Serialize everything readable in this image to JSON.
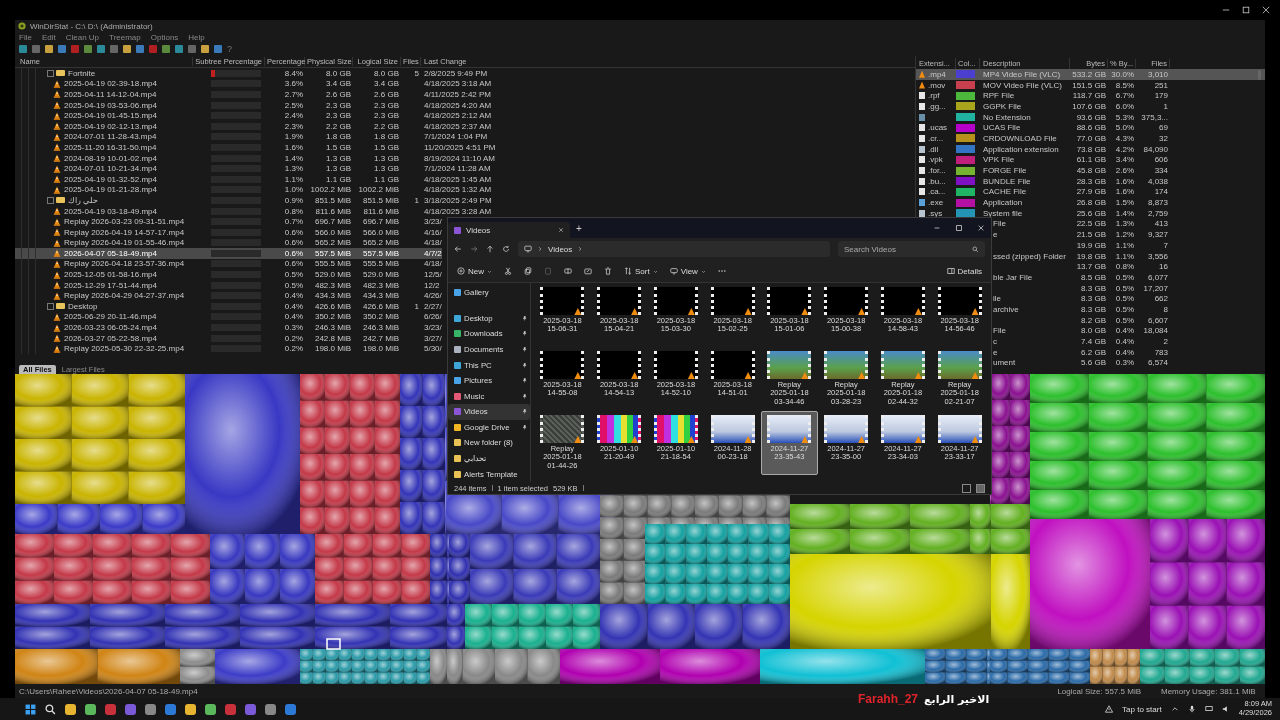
{
  "window": {
    "title": "WinDirStat - C:\\ D:\\ (Administrator)"
  },
  "menu": [
    "File",
    "Edit",
    "Clean Up",
    "Treemap",
    "Options",
    "Help"
  ],
  "toolbar": {
    "help": "?"
  },
  "tree": {
    "columns": [
      "Name",
      "Subtree Percentage",
      "Percentage",
      "Physical Size",
      "Logical Size",
      "Files",
      "Last Change"
    ],
    "rows": [
      {
        "kind": "folder",
        "name": "Fortnite",
        "level": 0.08,
        "pct": "8.4%",
        "phys": "8.0 GB",
        "logical": "8.0 GB",
        "files": "5",
        "changed": "2/8/2025  9:49 PM",
        "selected": false
      },
      {
        "kind": "file",
        "name": "2025-04-19 02-39-18.mp4",
        "pct": "3.6%",
        "phys": "3.4 GB",
        "logical": "3.4 GB",
        "changed": "4/18/2025  3:18 AM",
        "selected": false
      },
      {
        "kind": "file",
        "name": "2025-04-11 14-12-04.mp4",
        "pct": "2.7%",
        "phys": "2.6 GB",
        "logical": "2.6 GB",
        "changed": "4/11/2025  2:42 PM",
        "selected": false
      },
      {
        "kind": "file",
        "name": "2025-04-19 03-53-06.mp4",
        "pct": "2.5%",
        "phys": "2.3 GB",
        "logical": "2.3 GB",
        "changed": "4/18/2025  4:20 AM",
        "selected": false
      },
      {
        "kind": "file",
        "name": "2025-04-19 01-45-15.mp4",
        "pct": "2.4%",
        "phys": "2.3 GB",
        "logical": "2.3 GB",
        "changed": "4/18/2025  2:12 AM",
        "selected": false
      },
      {
        "kind": "file",
        "name": "2025-04-19 02-12-13.mp4",
        "pct": "2.3%",
        "phys": "2.2 GB",
        "logical": "2.2 GB",
        "changed": "4/18/2025  2:37 AM",
        "selected": false
      },
      {
        "kind": "file",
        "name": "2024-07-01 11-28-43.mp4",
        "pct": "1.9%",
        "phys": "1.8 GB",
        "logical": "1.8 GB",
        "changed": "7/1/2024  1:04 PM",
        "selected": false
      },
      {
        "kind": "file",
        "name": "2025-11-20 16-31-50.mp4",
        "pct": "1.6%",
        "phys": "1.5 GB",
        "logical": "1.5 GB",
        "changed": "11/20/2025  4:51 PM",
        "selected": false
      },
      {
        "kind": "file",
        "name": "2024-08-19 10-01-02.mp4",
        "pct": "1.4%",
        "phys": "1.3 GB",
        "logical": "1.3 GB",
        "changed": "8/19/2024  11:10 AM",
        "selected": false
      },
      {
        "kind": "file",
        "name": "2024-07-01 10-21-34.mp4",
        "pct": "1.3%",
        "phys": "1.3 GB",
        "logical": "1.3 GB",
        "changed": "7/1/2024  11:28 AM",
        "selected": false
      },
      {
        "kind": "file",
        "name": "2025-04-19 01-32-52.mp4",
        "pct": "1.1%",
        "phys": "1.1 GB",
        "logical": "1.1 GB",
        "changed": "4/18/2025  1:45 AM",
        "selected": false
      },
      {
        "kind": "file",
        "name": "2025-04-19 01-21-28.mp4",
        "pct": "1.0%",
        "phys": "1002.2 MiB",
        "logical": "1002.2 MiB",
        "changed": "4/18/2025  1:32 AM",
        "selected": false
      },
      {
        "kind": "folder",
        "name": "حلي راك",
        "pct": "0.9%",
        "phys": "851.5 MiB",
        "logical": "851.5 MiB",
        "files": "1",
        "changed": "3/18/2025  2:49 PM",
        "selected": false
      },
      {
        "kind": "file",
        "name": "2025-04-19 03-18-49.mp4",
        "pct": "0.8%",
        "phys": "811.6 MiB",
        "logical": "811.6 MiB",
        "changed": "4/18/2025  3:28 AM",
        "selected": false
      },
      {
        "kind": "file",
        "name": "Replay 2026-03-23 09-31-51.mp4",
        "pct": "0.7%",
        "phys": "696.7 MiB",
        "logical": "696.7 MiB",
        "changed": "3/23/",
        "selected": false
      },
      {
        "kind": "file",
        "name": "Replay 2026-04-19 14-57-17.mp4",
        "pct": "0.6%",
        "phys": "566.0 MiB",
        "logical": "566.0 MiB",
        "changed": "4/16/",
        "selected": false
      },
      {
        "kind": "file",
        "name": "Replay 2026-04-19 01-55-46.mp4",
        "pct": "0.6%",
        "phys": "565.2 MiB",
        "logical": "565.2 MiB",
        "changed": "4/18/",
        "selected": false
      },
      {
        "kind": "file",
        "name": "2026-04-07 05-18-49.mp4",
        "pct": "0.6%",
        "phys": "557.5 MiB",
        "logical": "557.5 MiB",
        "changed": "4/7/2",
        "selected": true
      },
      {
        "kind": "file",
        "name": "Replay 2026-04-18 23-57-36.mp4",
        "pct": "0.6%",
        "phys": "555.5 MiB",
        "logical": "555.5 MiB",
        "changed": "4/18/",
        "selected": false
      },
      {
        "kind": "file",
        "name": "2025-12-05 01-58-16.mp4",
        "pct": "0.5%",
        "phys": "529.0 MiB",
        "logical": "529.0 MiB",
        "changed": "12/5/",
        "selected": false
      },
      {
        "kind": "file",
        "name": "2025-12-29 17-51-44.mp4",
        "pct": "0.5%",
        "phys": "482.3 MiB",
        "logical": "482.3 MiB",
        "changed": "12/2",
        "selected": false
      },
      {
        "kind": "file",
        "name": "Replay 2026-04-29 04-27-37.mp4",
        "pct": "0.4%",
        "phys": "434.3 MiB",
        "logical": "434.3 MiB",
        "changed": "4/26/",
        "selected": false
      },
      {
        "kind": "folder",
        "name": "Desktop",
        "pct": "0.4%",
        "phys": "426.6 MiB",
        "logical": "426.6 MiB",
        "files": "1",
        "changed": "2/27/",
        "selected": false
      },
      {
        "kind": "file",
        "name": "2025-06-29 20-11-46.mp4",
        "pct": "0.4%",
        "phys": "350.2 MiB",
        "logical": "350.2 MiB",
        "changed": "6/26/",
        "selected": false
      },
      {
        "kind": "file",
        "name": "2026-03-23 06-05-24.mp4",
        "pct": "0.3%",
        "phys": "246.3 MiB",
        "logical": "246.3 MiB",
        "changed": "3/23/",
        "selected": false
      },
      {
        "kind": "file",
        "name": "2026-03-27 05-22-58.mp4",
        "pct": "0.2%",
        "phys": "242.8 MiB",
        "logical": "242.7 MiB",
        "changed": "3/27/",
        "selected": false
      },
      {
        "kind": "file",
        "name": "Replay 2025-05-30 22-32-25.mp4",
        "pct": "0.2%",
        "phys": "198.0 MiB",
        "logical": "198.0 MiB",
        "changed": "5/30/",
        "selected": false
      }
    ],
    "tabs": [
      {
        "label": "All Files",
        "selected": true
      },
      {
        "label": "Largest Files",
        "selected": false
      }
    ]
  },
  "extensions": {
    "columns": [
      "Extensi...",
      "Col...",
      "Description",
      "Bytes",
      "% By...",
      "Files"
    ],
    "rows": [
      {
        "kind": "vlc",
        "ext": ".mp4",
        "color": "#4b3fd0",
        "description": "MP4 Video File (VLC)",
        "bytes": "533.2 GB",
        "percent": "30.0%",
        "files": "3,010",
        "selected": true
      },
      {
        "kind": "vlc",
        "ext": ".mov",
        "color": "#c8404e",
        "description": "MOV Video File (VLC)",
        "bytes": "151.5 GB",
        "percent": "8.5%",
        "files": "251",
        "selected": false
      },
      {
        "kind": "doc",
        "ext": ".rpf",
        "color": "#4cb83c",
        "description": "RPF File",
        "bytes": "118.7 GB",
        "percent": "6.7%",
        "files": "179",
        "selected": false
      },
      {
        "kind": "doc",
        "ext": ".gg...",
        "color": "#a8a41c",
        "description": "GGPK File",
        "bytes": "107.6 GB",
        "percent": "6.0%",
        "files": "1",
        "selected": false
      },
      {
        "kind": "dir",
        "color": "#1fb3a0",
        "description": "No Extension",
        "bytes": "93.6 GB",
        "percent": "5.3%",
        "files": "375,3...",
        "selected": false
      },
      {
        "kind": "doc",
        "ext": ".ucas",
        "color": "#b400c8",
        "description": "UCAS File",
        "bytes": "88.6 GB",
        "percent": "5.0%",
        "files": "69",
        "selected": false
      },
      {
        "kind": "doc",
        "ext": ".cr...",
        "color": "#b8901c",
        "description": "CRDOWNLOAD File",
        "bytes": "77.0 GB",
        "percent": "4.3%",
        "files": "32",
        "selected": false
      },
      {
        "kind": "dll",
        "ext": ".dll",
        "color": "#3474c4",
        "description": "Application extension",
        "bytes": "73.8 GB",
        "percent": "4.2%",
        "files": "84,090",
        "selected": false
      },
      {
        "kind": "doc",
        "ext": ".vpk",
        "color": "#c0207c",
        "description": "VPK File",
        "bytes": "61.1 GB",
        "percent": "3.4%",
        "files": "606",
        "selected": false
      },
      {
        "kind": "doc",
        "ext": ".for...",
        "color": "#74b430",
        "description": "FORGE File",
        "bytes": "45.8 GB",
        "percent": "2.6%",
        "files": "334",
        "selected": false
      },
      {
        "kind": "doc",
        "ext": ".bu...",
        "color": "#8010c4",
        "description": "BUNDLE File",
        "bytes": "28.3 GB",
        "percent": "1.6%",
        "files": "4,038",
        "selected": false
      },
      {
        "kind": "doc",
        "ext": ".ca...",
        "color": "#20b464",
        "description": "CACHE File",
        "bytes": "27.9 GB",
        "percent": "1.6%",
        "files": "174",
        "selected": false
      },
      {
        "kind": "exe",
        "ext": ".exe",
        "color": "#b410a4",
        "description": "Application",
        "bytes": "26.8 GB",
        "percent": "1.5%",
        "files": "8,873",
        "selected": false
      },
      {
        "kind": "dll",
        "ext": ".sys",
        "color": "#2494b4",
        "description": "System file",
        "bytes": "25.6 GB",
        "percent": "1.4%",
        "files": "2,759",
        "selected": false
      },
      {
        "kind": "covered",
        "description": "File",
        "bytes": "22.5 GB",
        "percent": "1.3%",
        "files": "413",
        "selected": false
      },
      {
        "kind": "covered",
        "description": "e",
        "bytes": "21.5 GB",
        "percent": "1.2%",
        "files": "9,327",
        "selected": false
      },
      {
        "kind": "covered",
        "bytes": "19.9 GB",
        "percent": "1.1%",
        "files": "7",
        "selected": false
      },
      {
        "kind": "covered",
        "description": "ssed (zipped) Folder",
        "bytes": "19.8 GB",
        "percent": "1.1%",
        "files": "3,556",
        "selected": false
      },
      {
        "kind": "covered",
        "bytes": "13.7 GB",
        "percent": "0.8%",
        "files": "16",
        "selected": false
      },
      {
        "kind": "covered",
        "description": "ble Jar File",
        "bytes": "8.5 GB",
        "percent": "0.5%",
        "files": "6,077",
        "selected": false
      },
      {
        "kind": "covered",
        "bytes": "8.3 GB",
        "percent": "0.5%",
        "files": "17,207",
        "selected": false
      },
      {
        "kind": "covered",
        "description": "ile",
        "bytes": "8.3 GB",
        "percent": "0.5%",
        "files": "662",
        "selected": false
      },
      {
        "kind": "covered",
        "description": "archive",
        "bytes": "8.3 GB",
        "percent": "0.5%",
        "files": "8",
        "selected": false
      },
      {
        "kind": "covered",
        "bytes": "8.2 GB",
        "percent": "0.5%",
        "files": "6,607",
        "selected": false
      },
      {
        "kind": "covered",
        "description": "File",
        "bytes": "8.0 GB",
        "percent": "0.4%",
        "files": "18,084",
        "selected": false
      },
      {
        "kind": "covered",
        "description": "c",
        "bytes": "7.4 GB",
        "percent": "0.4%",
        "files": "2",
        "selected": false
      },
      {
        "kind": "covered",
        "description": "e",
        "bytes": "6.2 GB",
        "percent": "0.4%",
        "files": "783",
        "selected": false
      },
      {
        "kind": "covered",
        "description": "ument",
        "bytes": "5.6 GB",
        "percent": "0.3%",
        "files": "6,574",
        "selected": false
      }
    ]
  },
  "explorer": {
    "tab_title": "Videos",
    "new_tab": "+",
    "breadcrumb": "Videos",
    "search_placeholder": "Search Videos",
    "commands": [
      {
        "kind": "new",
        "label": "New"
      },
      {
        "kind": "cut"
      },
      {
        "kind": "copy"
      },
      {
        "kind": "paste",
        "disabled": true
      },
      {
        "kind": "rename"
      },
      {
        "kind": "share"
      },
      {
        "kind": "delete"
      },
      {
        "kind": "sort",
        "label": "Sort"
      },
      {
        "kind": "view",
        "label": "View"
      },
      {
        "kind": "more"
      }
    ],
    "details": "Details",
    "sidebar": [
      {
        "kind": "gallery",
        "label": "Gallery",
        "pinned": false,
        "selected": false
      },
      {
        "kind": "desktop",
        "label": "Desktop",
        "pinned": true,
        "selected": false
      },
      {
        "kind": "download",
        "label": "Downloads",
        "pinned": true,
        "selected": false
      },
      {
        "kind": "document",
        "label": "Documents",
        "pinned": true,
        "selected": false
      },
      {
        "kind": "pc",
        "label": "This PC",
        "pinned": true,
        "selected": false
      },
      {
        "kind": "pictures",
        "label": "Pictures",
        "pinned": true,
        "selected": false
      },
      {
        "kind": "music",
        "label": "Music",
        "pinned": true,
        "selected": false
      },
      {
        "kind": "videos",
        "label": "Videos",
        "pinned": true,
        "selected": true
      },
      {
        "kind": "drive",
        "label": "Google Drive",
        "pinned": true,
        "selected": false
      },
      {
        "kind": "folder",
        "label": "New folder (8)",
        "pinned": false,
        "selected": false
      },
      {
        "kind": "folder",
        "label": "تحدابي",
        "pinned": false,
        "selected": false
      },
      {
        "kind": "folder",
        "label": "Alerts Template",
        "pinned": false,
        "selected": false
      }
    ],
    "items": [
      {
        "kind": "black",
        "lines": [
          "2025-03-18",
          "15-06-31"
        ],
        "selected": false
      },
      {
        "kind": "black",
        "lines": [
          "2025-03-18",
          "15-04-21"
        ],
        "selected": false
      },
      {
        "kind": "black",
        "lines": [
          "2025-03-18",
          "15-03-30"
        ],
        "selected": false
      },
      {
        "kind": "black",
        "lines": [
          "2025-03-18",
          "15-02-25"
        ],
        "selected": false
      },
      {
        "kind": "black",
        "lines": [
          "2025-03-18",
          "15-01-06"
        ],
        "selected": false
      },
      {
        "kind": "black",
        "lines": [
          "2025-03-18",
          "15-00-38"
        ],
        "selected": false
      },
      {
        "kind": "black",
        "lines": [
          "2025-03-18",
          "14-58-43"
        ],
        "selected": false
      },
      {
        "kind": "black",
        "lines": [
          "2025-03-18",
          "14-56-46"
        ],
        "selected": false
      },
      {
        "kind": "black",
        "lines": [
          "2025-03-18",
          "14-55-08"
        ],
        "selected": false
      },
      {
        "kind": "black",
        "lines": [
          "2025-03-18",
          "14-54-13"
        ],
        "selected": false
      },
      {
        "kind": "black",
        "lines": [
          "2025-03-18",
          "14-52-10"
        ],
        "selected": false
      },
      {
        "kind": "black",
        "lines": [
          "2025-03-18",
          "14-51-01"
        ],
        "selected": false
      },
      {
        "kind": "game",
        "lines": [
          "Replay",
          "2025-01-18",
          "03-34-46"
        ],
        "selected": false
      },
      {
        "kind": "game",
        "lines": [
          "Replay",
          "2025-01-18",
          "03-28-23"
        ],
        "selected": false
      },
      {
        "kind": "game",
        "lines": [
          "Replay",
          "2025-01-18",
          "02-44-32"
        ],
        "selected": false
      },
      {
        "kind": "game",
        "lines": [
          "Replay",
          "2025-01-18",
          "02-21-07"
        ],
        "selected": false
      },
      {
        "kind": "static",
        "lines": [
          "Replay",
          "2025-01-18",
          "01-44-26"
        ],
        "selected": false
      },
      {
        "kind": "bars",
        "lines": [
          "2025-01-10",
          "21-20-49"
        ],
        "selected": false
      },
      {
        "kind": "bars",
        "lines": [
          "2025-01-10",
          "21-18-54"
        ],
        "selected": false
      },
      {
        "kind": "people",
        "lines": [
          "2024-11-28",
          "00-23-18"
        ],
        "selected": false
      },
      {
        "kind": "people",
        "lines": [
          "2024-11-27",
          "23-35-43"
        ],
        "selected": true
      },
      {
        "kind": "people",
        "lines": [
          "2024-11-27",
          "23-35-00"
        ],
        "selected": false
      },
      {
        "kind": "people",
        "lines": [
          "2024-11-27",
          "23-34-03"
        ],
        "selected": false
      },
      {
        "kind": "people",
        "lines": [
          "2024-11-27",
          "23-33-17"
        ],
        "selected": false
      }
    ],
    "status": [
      "244 items",
      "1 item selected",
      "529 KB"
    ]
  },
  "status_bar": {
    "path": "C:\\Users\\Rahee\\Videos\\2026-04-07 05-18-49.mp4",
    "logical_size": "Logical Size: 557.5 MiB",
    "memory": "Memory Usage: 381.1 MiB"
  },
  "overlay": {
    "name": "Farahh_27",
    "caption": "الاخير الرابع"
  },
  "taskbar": {
    "notification": "Tap to start",
    "time": "8:09 AM",
    "date": "4/29/2026"
  }
}
